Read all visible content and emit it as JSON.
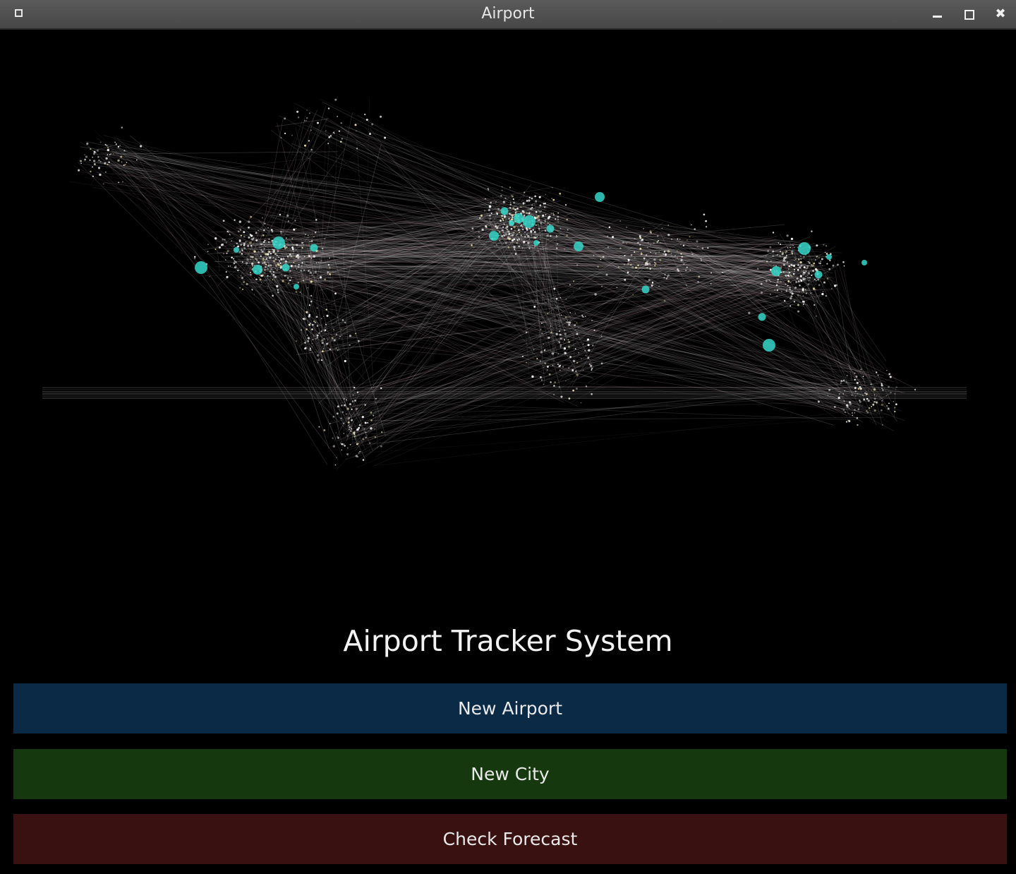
{
  "window": {
    "title": "Airport",
    "icons": {
      "app": "window-icon",
      "minimize": "minimize-icon",
      "maximize": "maximize-icon",
      "close": "close-icon"
    },
    "close_glyph": "✖"
  },
  "hero": {
    "description_icon": "global-flight-network-image"
  },
  "main": {
    "title": "Airport Tracker System",
    "buttons": [
      {
        "label": "New Airport",
        "color": "#0a2a45"
      },
      {
        "label": "New City",
        "color": "#16380f"
      },
      {
        "label": "Check Forecast",
        "color": "#3a1111"
      }
    ]
  },
  "colors": {
    "background": "#000000",
    "hub_nodes": "#35d6c9",
    "route_lines": "#d8d8d8",
    "dense_routes": "#e9b8c4"
  }
}
